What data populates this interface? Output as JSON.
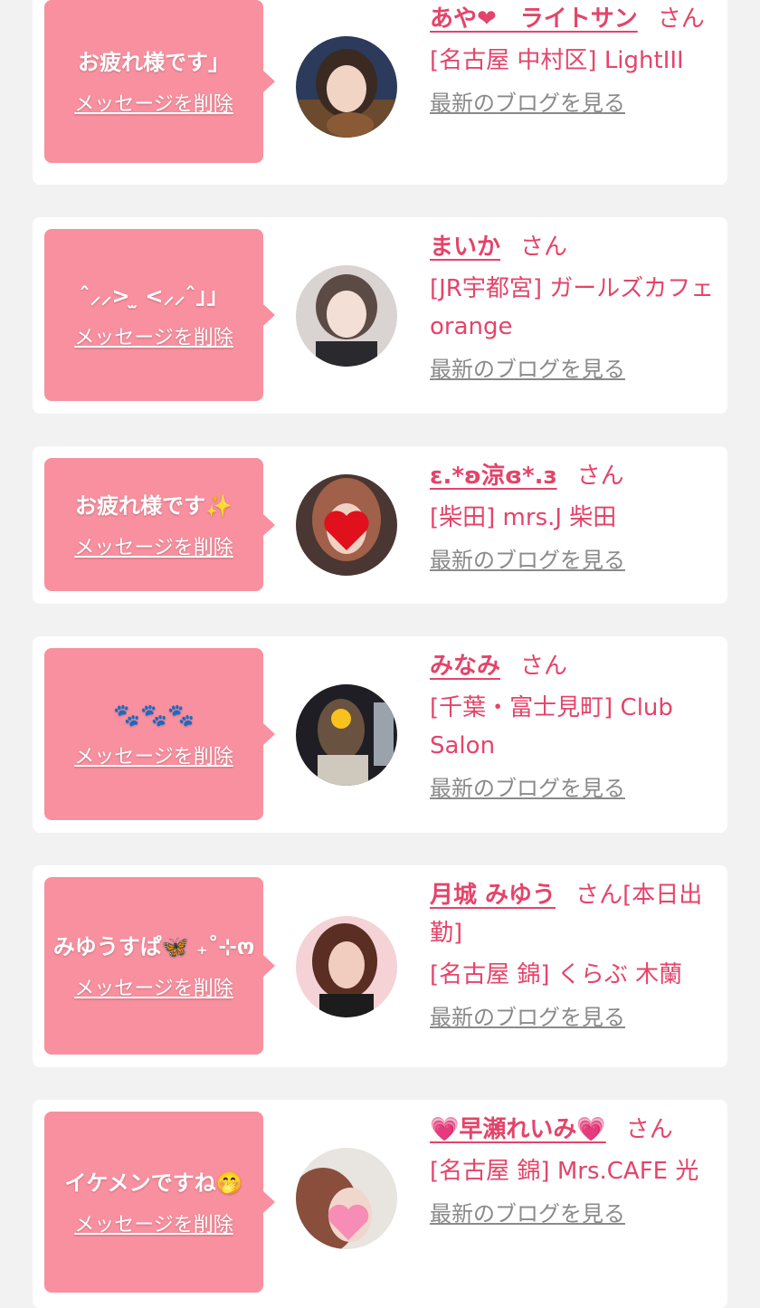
{
  "common": {
    "delete_label": "メッセージを削除",
    "blog_label": "最新のブログを見る",
    "san_label": "さん"
  },
  "colors": {
    "bubble": "#f8909f",
    "accent": "#e4446a",
    "link_gray": "#8a8a8a",
    "background": "#f2f2f2"
  },
  "cards": [
    {
      "message": "お疲れ様です」",
      "name": "あや❤　ライトサン",
      "suffix": "",
      "shop": "[名古屋 中村区] LightIII",
      "avatar_icon": "user-photo-avatar"
    },
    {
      "message": "ˆ⸝⸝> ̫ <⸝⸝ˆ」」",
      "name": "まいか",
      "suffix": "",
      "shop": "[JR宇都宮] ガールズカフェ orange",
      "avatar_icon": "user-photo-avatar"
    },
    {
      "message": "お疲れ様です✨",
      "name": "ε.*ʚ涼ɞ*.з",
      "suffix": "",
      "shop": "[柴田] mrs.J 柴田",
      "avatar_icon": "user-photo-avatar-heart-sticker"
    },
    {
      "message": "🐾🐾🐾",
      "name": "みなみ",
      "suffix": "",
      "shop": "[千葉・富士見町] Club Salon",
      "avatar_icon": "user-photo-avatar-emoji-sticker"
    },
    {
      "message": "みゆうすぱ🦋 ₊˚⊹ო",
      "name": "月城 みゆう",
      "suffix": "[本日出勤]",
      "shop": "[名古屋 錦] くらぶ 木蘭",
      "avatar_icon": "user-photo-avatar"
    },
    {
      "message": "イケメンですね🤭",
      "name": "💗早瀬れいみ💗",
      "suffix": "",
      "shop": "[名古屋 錦] Mrs.CAFE 光",
      "avatar_icon": "user-photo-avatar-heart-sticker"
    }
  ]
}
